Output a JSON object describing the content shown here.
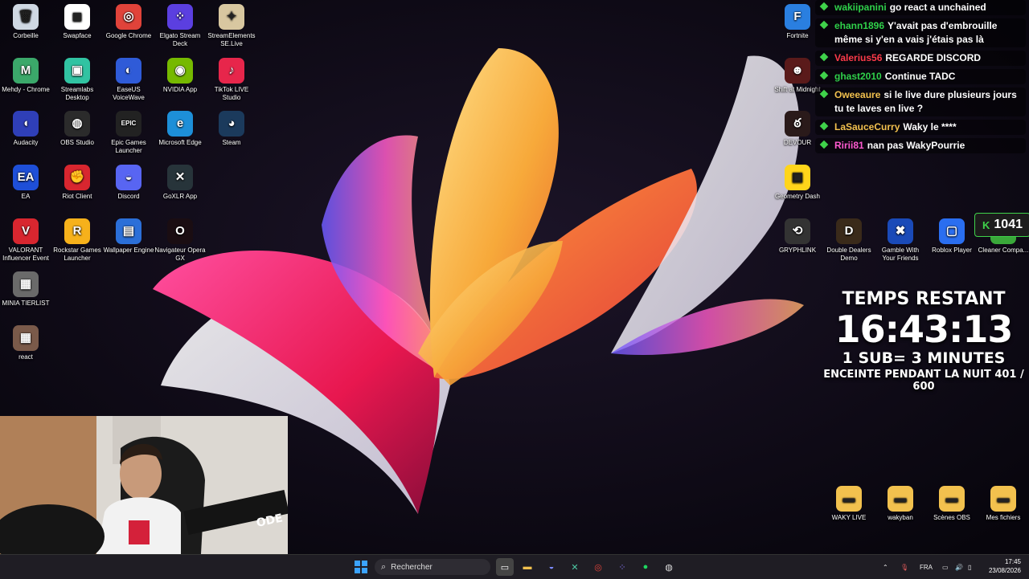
{
  "desktop_icons_left": [
    {
      "label": "Corbeille",
      "icon": "recycle-bin-icon",
      "color": "#cfd8e3",
      "glyph": "🗑",
      "name": "corbeille"
    },
    {
      "label": "Swapface",
      "icon": "swapface-icon",
      "color": "#ffffff",
      "glyph": "◼",
      "name": "swapface"
    },
    {
      "label": "Google Chrome",
      "icon": "chrome-icon",
      "color": "#e0433a",
      "glyph": "◎",
      "name": "google-chrome"
    },
    {
      "label": "Elgato Stream Deck",
      "icon": "stream-deck-icon",
      "color": "#5b3fe0",
      "glyph": "⁘",
      "name": "elgato-stream-deck"
    },
    {
      "label": "StreamElements SE.Live",
      "icon": "streamelements-icon",
      "color": "#d8c7a0",
      "glyph": "✦",
      "name": "streamelements"
    },
    {
      "label": "Mehdy - Chrome",
      "icon": "chrome-profile-icon",
      "color": "#3ba86a",
      "glyph": "M",
      "name": "mehdy-chrome"
    },
    {
      "label": "Streamlabs Desktop",
      "icon": "streamlabs-icon",
      "color": "#31c3a2",
      "glyph": "▣",
      "name": "streamlabs-desktop"
    },
    {
      "label": "EaseUS VoiceWave",
      "icon": "voicewave-icon",
      "color": "#2f5bd8",
      "glyph": "◐",
      "name": "easeus-voicewave"
    },
    {
      "label": "NVIDIA App",
      "icon": "nvidia-icon",
      "color": "#76b900",
      "glyph": "◉",
      "name": "nvidia-app"
    },
    {
      "label": "TikTok LIVE Studio",
      "icon": "tiktok-icon",
      "color": "#e7264b",
      "glyph": "♪",
      "name": "tiktok-live-studio"
    },
    {
      "label": "Audacity",
      "icon": "audacity-icon",
      "color": "#2f3fb8",
      "glyph": "◖",
      "name": "audacity"
    },
    {
      "label": "OBS Studio",
      "icon": "obs-icon",
      "color": "#2b2b2b",
      "glyph": "◍",
      "name": "obs-studio"
    },
    {
      "label": "Epic Games Launcher",
      "icon": "epic-games-icon",
      "color": "#222222",
      "glyph": "EPIC",
      "name": "epic-games-launcher"
    },
    {
      "label": "Microsoft Edge",
      "icon": "edge-icon",
      "color": "#1d8fd8",
      "glyph": "e",
      "name": "microsoft-edge"
    },
    {
      "label": "Steam",
      "icon": "steam-icon",
      "color": "#1b3a5c",
      "glyph": "◕",
      "name": "steam"
    },
    {
      "label": "EA",
      "icon": "ea-icon",
      "color": "#1e4fd8",
      "glyph": "EA",
      "name": "ea"
    },
    {
      "label": "Riot Client",
      "icon": "riot-icon",
      "color": "#d8262f",
      "glyph": "✊",
      "name": "riot-client"
    },
    {
      "label": "Discord",
      "icon": "discord-icon",
      "color": "#5865f2",
      "glyph": "◒",
      "name": "discord"
    },
    {
      "label": "GoXLR App",
      "icon": "goxlr-icon",
      "color": "#27343a",
      "glyph": "✕",
      "name": "goxlr-app"
    },
    {
      "label": "VALORANT Influencer Event",
      "icon": "valorant-icon",
      "color": "#d8262f",
      "glyph": "V",
      "name": "valorant-influencer-event"
    },
    {
      "label": "Rockstar Games Launcher",
      "icon": "rockstar-icon",
      "color": "#f6b11b",
      "glyph": "R",
      "name": "rockstar-games-launcher"
    },
    {
      "label": "Wallpaper Engine",
      "icon": "wallpaper-engine-icon",
      "color": "#2b6fd8",
      "glyph": "▤",
      "name": "wallpaper-engine"
    },
    {
      "label": "Navigateur Opera GX",
      "icon": "opera-gx-icon",
      "color": "#1a0d12",
      "glyph": "O",
      "name": "navigateur-opera-gx"
    },
    {
      "label": "MINIA TIERLIST",
      "icon": "image-thumbnail-icon",
      "color": "#6a6a6a",
      "glyph": "▦",
      "name": "minia-tierlist"
    },
    {
      "label": "react",
      "icon": "image-thumbnail-icon",
      "color": "#7a5a4a",
      "glyph": "▦",
      "name": "react"
    }
  ],
  "desktop_icons_right": [
    {
      "label": "Fortnite",
      "icon": "fortnite-icon",
      "color": "#2a7fe0",
      "glyph": "F",
      "name": "fortnite"
    },
    {
      "label": "Shift at Midnight",
      "icon": "game-icon",
      "color": "#5a1a1a",
      "glyph": "☻",
      "name": "shift-at-midnight"
    },
    {
      "label": "DEVOUR",
      "icon": "devour-icon",
      "color": "#2a1a1a",
      "glyph": "ఠ",
      "name": "devour"
    },
    {
      "label": "Geometry Dash",
      "icon": "geometry-dash-icon",
      "color": "#ffd51a",
      "glyph": "▣",
      "name": "geometry-dash"
    },
    {
      "label": "GRYPHLINK",
      "icon": "gryphlink-icon",
      "color": "#333333",
      "glyph": "⟲",
      "name": "gryphlink"
    },
    {
      "label": "Double Dealers Demo",
      "icon": "game-icon",
      "color": "#3a2a1a",
      "glyph": "D",
      "name": "double-dealers-demo"
    },
    {
      "label": "Gamble With Your Friends",
      "icon": "game-icon",
      "color": "#1a4ab8",
      "glyph": "✖",
      "name": "gamble-with-your-friends"
    },
    {
      "label": "Roblox Player",
      "icon": "roblox-icon",
      "color": "#2a6ef0",
      "glyph": "▢",
      "name": "roblox-player"
    },
    {
      "label": "Cleaner Compa...",
      "icon": "game-icon",
      "color": "#3aa83a",
      "glyph": "♣",
      "name": "cleaner-compa"
    },
    {
      "label": "WAKY LIVE",
      "icon": "folder-icon",
      "color": "#f2c14e",
      "glyph": "▬",
      "name": "waky-live"
    },
    {
      "label": "wakyban",
      "icon": "folder-icon",
      "color": "#f2c14e",
      "glyph": "▬",
      "name": "wakyban"
    },
    {
      "label": "Scènes OBS",
      "icon": "folder-icon",
      "color": "#f2c14e",
      "glyph": "▬",
      "name": "scenes-obs"
    },
    {
      "label": "Mes fichiers",
      "icon": "folder-icon",
      "color": "#f2c14e",
      "glyph": "▬",
      "name": "mes-fichiers"
    }
  ],
  "chat": [
    {
      "user": "wakiipanini",
      "user_color": "#2fd04a",
      "text": "go react a unchained"
    },
    {
      "user": "ehann1896",
      "user_color": "#2fd04a",
      "text": "Y'avait pas d'embrouille même si y'en a vais j'étais pas là"
    },
    {
      "user": "Valerius56",
      "user_color": "#ff3b4a",
      "text": "REGARDE DISCORD"
    },
    {
      "user": "ghast2010",
      "user_color": "#2fd04a",
      "text": "Continue TADC"
    },
    {
      "user": "Oweeaure",
      "user_color": "#f2c14e",
      "text": "si le live dure plusieurs jours tu te laves en live ?"
    },
    {
      "user": "LaSauceCurry",
      "user_color": "#f2c14e",
      "text": "Waky le ****"
    },
    {
      "user": "Ririi81",
      "user_color": "#ff5ad0",
      "text": "nan pas WakyPourrie"
    }
  ],
  "sub_counter": "1041",
  "timer": {
    "title": "TEMPS RESTANT",
    "value": "16:43:13",
    "rule": "1 SUB= 3 MINUTES",
    "goal": "ENCEINTE PENDANT LA NUIT 401 / 600"
  },
  "taskbar": {
    "search_placeholder": "Rechercher",
    "lang": "FRA",
    "time": "17:45",
    "date": "23/08/2026"
  }
}
